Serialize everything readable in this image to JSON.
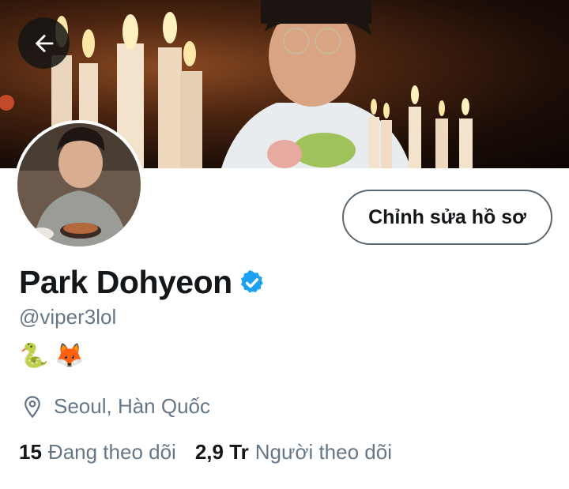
{
  "header": {
    "back_icon": "arrow-left-icon"
  },
  "profile": {
    "edit_button_label": "Chỉnh sửa hồ sơ",
    "name": "Park Dohyeon",
    "verified_icon": "verified-badge-icon",
    "handle": "@viper3lol",
    "bio_emojis": [
      "🐍",
      "🦊"
    ],
    "location_icon": "location-pin-icon",
    "location": "Seoul, Hàn Quốc",
    "following_count": "15",
    "following_label": "Đang theo dõi",
    "followers_count": "2,9 Tr",
    "followers_label": "Người theo dõi"
  },
  "colors": {
    "accent": "#1da1f2",
    "text_primary": "#14171a",
    "text_secondary": "#657786"
  }
}
